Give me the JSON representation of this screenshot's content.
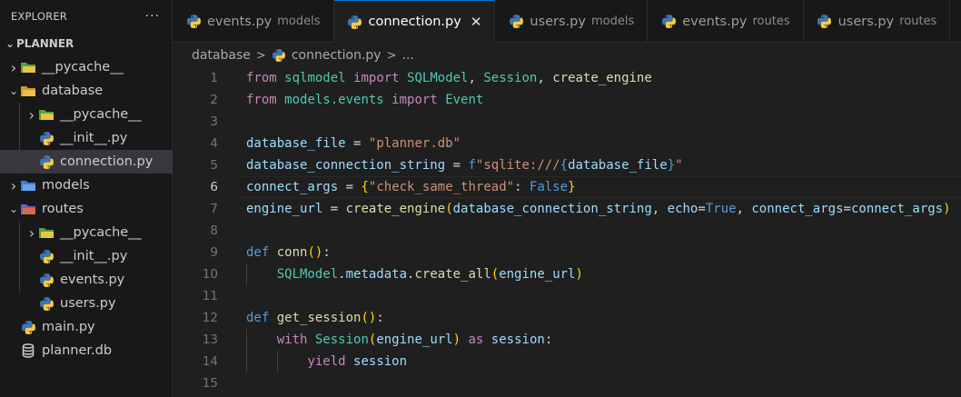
{
  "explorer": {
    "title": "EXPLORER",
    "more": "···",
    "root": "PLANNER",
    "items": [
      {
        "label": "__pycache__",
        "type": "folder",
        "chev": "›",
        "icon": "pycache-folder-icon",
        "depth": 0
      },
      {
        "label": "database",
        "type": "folder-open",
        "chev": "⌄",
        "icon": "database-folder-icon",
        "depth": 0
      },
      {
        "label": "__pycache__",
        "type": "folder",
        "chev": "›",
        "icon": "pycache-folder-icon",
        "depth": 1
      },
      {
        "label": "__init__.py",
        "type": "file",
        "chev": "",
        "icon": "python-icon",
        "depth": 1
      },
      {
        "label": "connection.py",
        "type": "file",
        "chev": "",
        "icon": "python-icon",
        "depth": 1,
        "selected": true
      },
      {
        "label": "models",
        "type": "folder",
        "chev": "›",
        "icon": "models-folder-icon",
        "depth": 0
      },
      {
        "label": "routes",
        "type": "folder-open",
        "chev": "⌄",
        "icon": "routes-folder-icon",
        "depth": 0
      },
      {
        "label": "__pycache__",
        "type": "folder",
        "chev": "›",
        "icon": "pycache-folder-icon",
        "depth": 1
      },
      {
        "label": "__init__.py",
        "type": "file",
        "chev": "",
        "icon": "python-icon",
        "depth": 1
      },
      {
        "label": "events.py",
        "type": "file",
        "chev": "",
        "icon": "python-icon",
        "depth": 1
      },
      {
        "label": "users.py",
        "type": "file",
        "chev": "",
        "icon": "python-icon",
        "depth": 1
      },
      {
        "label": "main.py",
        "type": "file",
        "chev": "",
        "icon": "python-icon",
        "depth": 0
      },
      {
        "label": "planner.db",
        "type": "file",
        "chev": "",
        "icon": "database-icon",
        "depth": 0
      }
    ]
  },
  "tabs": [
    {
      "name": "events.py",
      "desc": "models",
      "active": false
    },
    {
      "name": "connection.py",
      "desc": "",
      "active": true,
      "close": "✕"
    },
    {
      "name": "users.py",
      "desc": "models",
      "active": false
    },
    {
      "name": "events.py",
      "desc": "routes",
      "active": false
    },
    {
      "name": "users.py",
      "desc": "routes",
      "active": false
    }
  ],
  "breadcrumb": {
    "folder": "database",
    "sep": ">",
    "file": "connection.py",
    "tail": "..."
  },
  "editor": {
    "current_line": 6,
    "lines": [
      [
        [
          "kw",
          "from"
        ],
        [
          "plain",
          " "
        ],
        [
          "mod",
          "sqlmodel"
        ],
        [
          "plain",
          " "
        ],
        [
          "kw",
          "import"
        ],
        [
          "plain",
          " "
        ],
        [
          "cls",
          "SQLModel"
        ],
        [
          "plain",
          ", "
        ],
        [
          "cls",
          "Session"
        ],
        [
          "plain",
          ", "
        ],
        [
          "fn",
          "create_engine"
        ]
      ],
      [
        [
          "kw",
          "from"
        ],
        [
          "plain",
          " "
        ],
        [
          "mod",
          "models.events"
        ],
        [
          "plain",
          " "
        ],
        [
          "kw",
          "import"
        ],
        [
          "plain",
          " "
        ],
        [
          "cls",
          "Event"
        ]
      ],
      [],
      [
        [
          "var",
          "database_file"
        ],
        [
          "plain",
          " "
        ],
        [
          "op",
          "="
        ],
        [
          "plain",
          " "
        ],
        [
          "str",
          "\"planner.db\""
        ]
      ],
      [
        [
          "var",
          "database_connection_string"
        ],
        [
          "plain",
          " "
        ],
        [
          "op",
          "="
        ],
        [
          "plain",
          " "
        ],
        [
          "kw2",
          "f"
        ],
        [
          "str",
          "\"sqlite:///"
        ],
        [
          "kw2",
          "{"
        ],
        [
          "var",
          "database_file"
        ],
        [
          "kw2",
          "}"
        ],
        [
          "str",
          "\""
        ]
      ],
      [
        [
          "var",
          "connect_args"
        ],
        [
          "plain",
          " "
        ],
        [
          "op",
          "="
        ],
        [
          "plain",
          " "
        ],
        [
          "brk",
          "{"
        ],
        [
          "str",
          "\"check_same_thread\""
        ],
        [
          "plain",
          ": "
        ],
        [
          "kw2",
          "False"
        ],
        [
          "brk",
          "}"
        ]
      ],
      [
        [
          "var",
          "engine_url"
        ],
        [
          "plain",
          " "
        ],
        [
          "op",
          "="
        ],
        [
          "plain",
          " "
        ],
        [
          "fn",
          "create_engine"
        ],
        [
          "brk",
          "("
        ],
        [
          "var",
          "database_connection_string"
        ],
        [
          "plain",
          ", "
        ],
        [
          "var",
          "echo"
        ],
        [
          "op",
          "="
        ],
        [
          "kw2",
          "True"
        ],
        [
          "plain",
          ", "
        ],
        [
          "var",
          "connect_args"
        ],
        [
          "op",
          "="
        ],
        [
          "var",
          "connect_args"
        ],
        [
          "brk",
          ")"
        ]
      ],
      [],
      [
        [
          "kw2",
          "def"
        ],
        [
          "plain",
          " "
        ],
        [
          "fn",
          "conn"
        ],
        [
          "brk",
          "()"
        ],
        [
          "plain",
          ":"
        ]
      ],
      [
        [
          "plain",
          "    "
        ],
        [
          "cls",
          "SQLModel"
        ],
        [
          "plain",
          "."
        ],
        [
          "var",
          "metadata"
        ],
        [
          "plain",
          "."
        ],
        [
          "fn",
          "create_all"
        ],
        [
          "brk",
          "("
        ],
        [
          "var",
          "engine_url"
        ],
        [
          "brk",
          ")"
        ]
      ],
      [],
      [
        [
          "kw2",
          "def"
        ],
        [
          "plain",
          " "
        ],
        [
          "fn",
          "get_session"
        ],
        [
          "brk",
          "()"
        ],
        [
          "plain",
          ":"
        ]
      ],
      [
        [
          "plain",
          "    "
        ],
        [
          "kw",
          "with"
        ],
        [
          "plain",
          " "
        ],
        [
          "cls",
          "Session"
        ],
        [
          "brk",
          "("
        ],
        [
          "var",
          "engine_url"
        ],
        [
          "brk",
          ")"
        ],
        [
          "plain",
          " "
        ],
        [
          "kw",
          "as"
        ],
        [
          "plain",
          " "
        ],
        [
          "var",
          "session"
        ],
        [
          "plain",
          ":"
        ]
      ],
      [
        [
          "plain",
          "        "
        ],
        [
          "kw",
          "yield"
        ],
        [
          "plain",
          " "
        ],
        [
          "var",
          "session"
        ]
      ],
      []
    ]
  },
  "colors": {
    "accent": "#0078d4",
    "python_blue": "#3b78b7",
    "python_yellow": "#f7c948"
  }
}
